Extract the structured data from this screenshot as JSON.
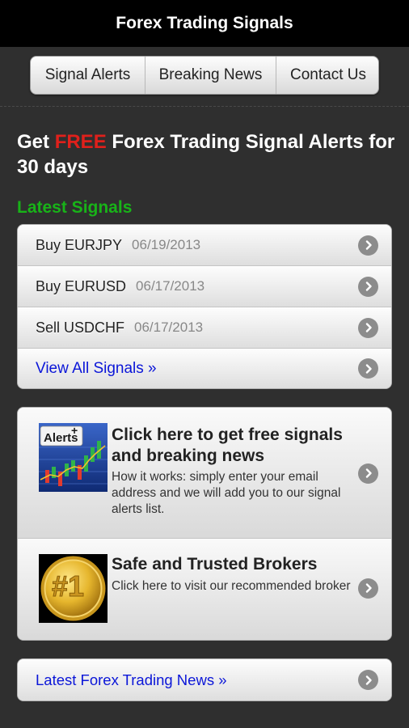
{
  "app": {
    "title": "Forex Trading Signals"
  },
  "nav": {
    "items": [
      {
        "label": "Signal Alerts"
      },
      {
        "label": "Breaking News"
      },
      {
        "label": "Contact Us"
      }
    ]
  },
  "headline": {
    "prefix": "Get ",
    "highlight": "FREE",
    "suffix": " Forex Trading Signal Alerts for 30 days"
  },
  "signals": {
    "title": "Latest Signals",
    "items": [
      {
        "label": "Buy EURJPY",
        "date": "06/19/2013"
      },
      {
        "label": "Buy EURUSD",
        "date": "06/17/2013"
      },
      {
        "label": "Sell USDCHF",
        "date": "06/17/2013"
      }
    ],
    "view_all": "View All Signals »"
  },
  "promos": [
    {
      "icon": "alerts-chart-icon",
      "icon_label": "Alerts",
      "title": "Click here to get free signals and breaking news",
      "desc": "How it works: simply enter your email address and we will add you to our signal alerts list."
    },
    {
      "icon": "gold-medal-number-one-icon",
      "icon_label": "#1",
      "title": "Safe and Trusted Brokers",
      "desc": "Click here to visit our recommended broker"
    }
  ],
  "news": {
    "label": "Latest Forex Trading News »"
  },
  "colors": {
    "background": "#2f2f2f",
    "free": "#e0201b",
    "section_title": "#18b318",
    "link": "#0b16d8"
  }
}
